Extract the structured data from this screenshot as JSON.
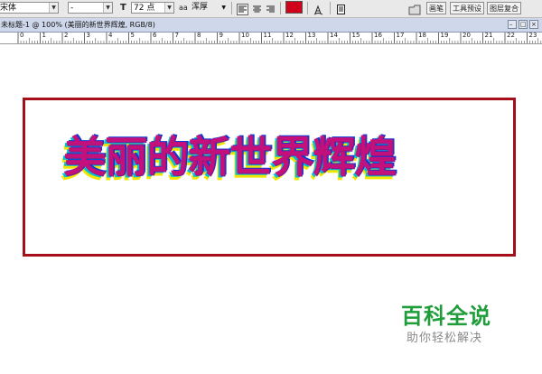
{
  "options_bar": {
    "font_family": "宋体",
    "font_style": "-",
    "font_size": "72 点",
    "aa_icon": "aa",
    "anti_alias": "浑厚",
    "text_color": "#d0021b",
    "panel_tabs": [
      "画笔",
      "工具预设",
      "图层复合"
    ]
  },
  "document": {
    "title": "未标题-1 @ 100% (美丽的新世界辉煌, RGB/8)"
  },
  "ruler": {
    "labels": [
      "0",
      "1",
      "2",
      "3",
      "4",
      "5",
      "6",
      "7",
      "8",
      "9",
      "10",
      "11",
      "12",
      "13",
      "14",
      "15",
      "16",
      "17",
      "18",
      "19",
      "20",
      "21",
      "22",
      "23"
    ]
  },
  "canvas": {
    "art_text": "美丽的新世界辉煌",
    "frame_color": "#a40f1a",
    "text_colors": [
      "#f2e600",
      "#00c2d6",
      "#0b3bd4",
      "#c4107a"
    ]
  },
  "watermark": {
    "title": "百科全说",
    "subtitle": "助你轻松解决"
  }
}
